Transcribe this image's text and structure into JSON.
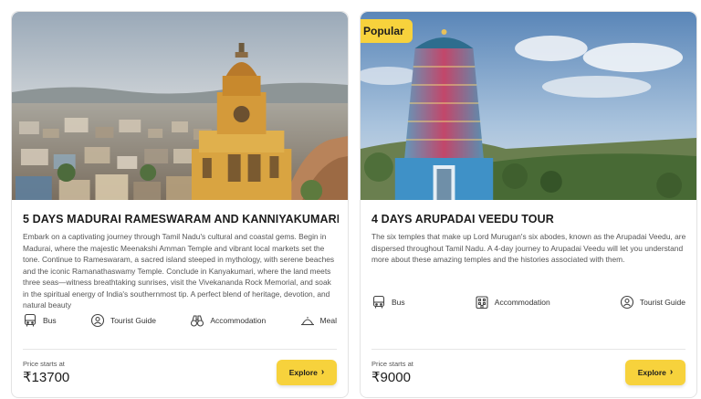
{
  "colors": {
    "accent": "#f7d23c",
    "text": "#1c1c1c",
    "muted": "#555555",
    "border": "#e3e3e3"
  },
  "cards": [
    {
      "title": "5 DAYS MADURAI RAMESWARAM AND KANNIYAKUMARI TOUR",
      "description": "Embark on a captivating journey through Tamil Nadu's cultural and coastal gems. Begin in Madurai, where the majestic Meenakshi Amman Temple and vibrant local markets set the tone. Continue to Rameswaram, a sacred island steeped in mythology, with serene beaches and the iconic Ramanathaswamy Temple. Conclude in Kanyakumari, where the land meets three seas—witness breathtaking sunrises, visit the Vivekananda Rock Memorial, and soak in the spiritual energy of India's southernmost tip. A perfect blend of heritage, devotion, and natural beauty",
      "features": [
        {
          "icon": "bus-icon",
          "label": "Bus"
        },
        {
          "icon": "tourist-guide-icon",
          "label": "Tourist Guide"
        },
        {
          "icon": "binoculars-icon",
          "label": "Accommodation"
        },
        {
          "icon": "meal-cloche-icon",
          "label": "Meal"
        }
      ],
      "price_label": "Price starts at",
      "price": "₹13700",
      "button_label": "Explore",
      "button_icon": "chevron-right-icon"
    },
    {
      "badge": "Popular",
      "title": "4 DAYS ARUPADAI VEEDU TOUR",
      "description": "The six temples that make up Lord Murugan's six abodes, known as the Arupadai Veedu, are dispersed throughout Tamil Nadu. A 4-day journey to Arupadai Veedu will let you understand more about these amazing temples and the histories associated with them.",
      "features": [
        {
          "icon": "bus-icon",
          "label": "Bus"
        },
        {
          "icon": "building-icon",
          "label": "Accommodation"
        },
        {
          "icon": "tourist-guide-icon",
          "label": "Tourist Guide"
        }
      ],
      "price_label": "Price starts at",
      "price": "₹9000",
      "button_label": "Explore",
      "button_icon": "chevron-right-icon"
    }
  ]
}
